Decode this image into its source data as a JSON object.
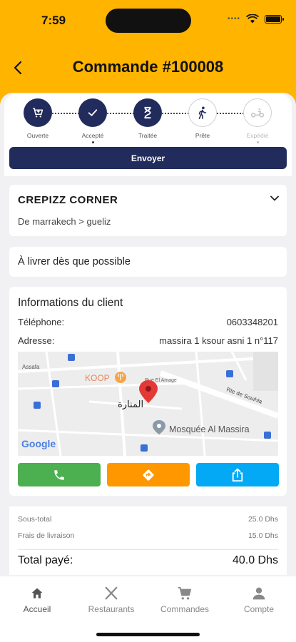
{
  "status": {
    "time": "7:59"
  },
  "header": {
    "title": "Commande #100008"
  },
  "stepper": {
    "steps": [
      {
        "label": "Ouverte",
        "state": "done",
        "icon": "cart-icon"
      },
      {
        "label": "Accepté",
        "state": "done",
        "icon": "check-icon"
      },
      {
        "label": "Traitée",
        "state": "done",
        "icon": "hourglass-icon"
      },
      {
        "label": "Prête",
        "state": "todo",
        "icon": "walking-person-icon"
      },
      {
        "label": "Expédié",
        "state": "todo",
        "icon": "moped-icon"
      }
    ],
    "send_label": "Envoyer"
  },
  "store": {
    "name": "CREPIZZ CORNER",
    "route": "De marrakech > gueliz"
  },
  "delivery": {
    "text": "À livrer dès que possible"
  },
  "client": {
    "title": "Informations du client",
    "phone_label": "Téléphone:",
    "phone": "0603348201",
    "address_label": "Adresse:",
    "address": "massira 1 ksour asni 1 n°117"
  },
  "map": {
    "labels": {
      "koop": "KOOP",
      "arabic": "المنارة",
      "mosque": "Mosquée Al Massira",
      "assafa": "Assafa",
      "street": "Rte de Souihla",
      "street2": "Rue El Amage",
      "google": "Google"
    }
  },
  "totals": {
    "subtotal_label": "Sous-total",
    "subtotal": "25.0 Dhs",
    "delivery_label": "Frais de livraison",
    "delivery": "15.0 Dhs",
    "total_label": "Total payé:",
    "total": "40.0 Dhs"
  },
  "tabs": [
    {
      "label": "Accueil",
      "icon": "home-icon"
    },
    {
      "label": "Restaurants",
      "icon": "fork-knife-icon"
    },
    {
      "label": "Commandes",
      "icon": "cart-icon"
    },
    {
      "label": "Compte",
      "icon": "person-icon"
    }
  ],
  "colors": {
    "accent": "#ffb400",
    "navy": "#222c5c",
    "call": "#4caf50",
    "directions": "#ff9800",
    "share": "#03a9f4"
  }
}
